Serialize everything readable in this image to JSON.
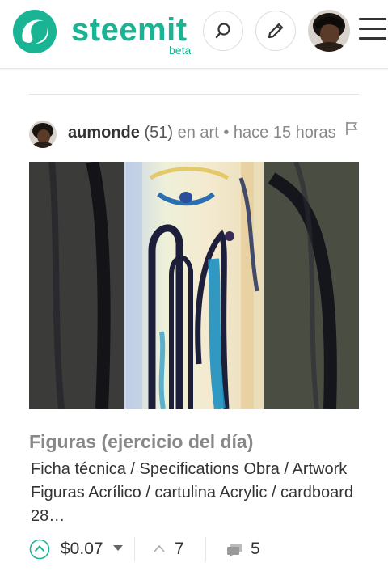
{
  "header": {
    "logo_text": "steemit",
    "logo_badge": "beta",
    "brand_color": "#1ab394",
    "icons": [
      "steemit-logo-icon",
      "search-icon",
      "pencil-icon",
      "user-avatar",
      "hamburger-menu-icon"
    ]
  },
  "post": {
    "author": "aumonde",
    "reputation": "(51)",
    "category_text": "en art",
    "separator": "•",
    "time_text": "hace 15 horas",
    "title": "Figuras (ejercicio del día)",
    "summary": "Ficha técnica / Specifications Obra / Artwork Figuras Acrílico / cartulina Acrylic / cardboard 28…",
    "payout": "$0.07",
    "votes": "7",
    "comments": "5"
  }
}
